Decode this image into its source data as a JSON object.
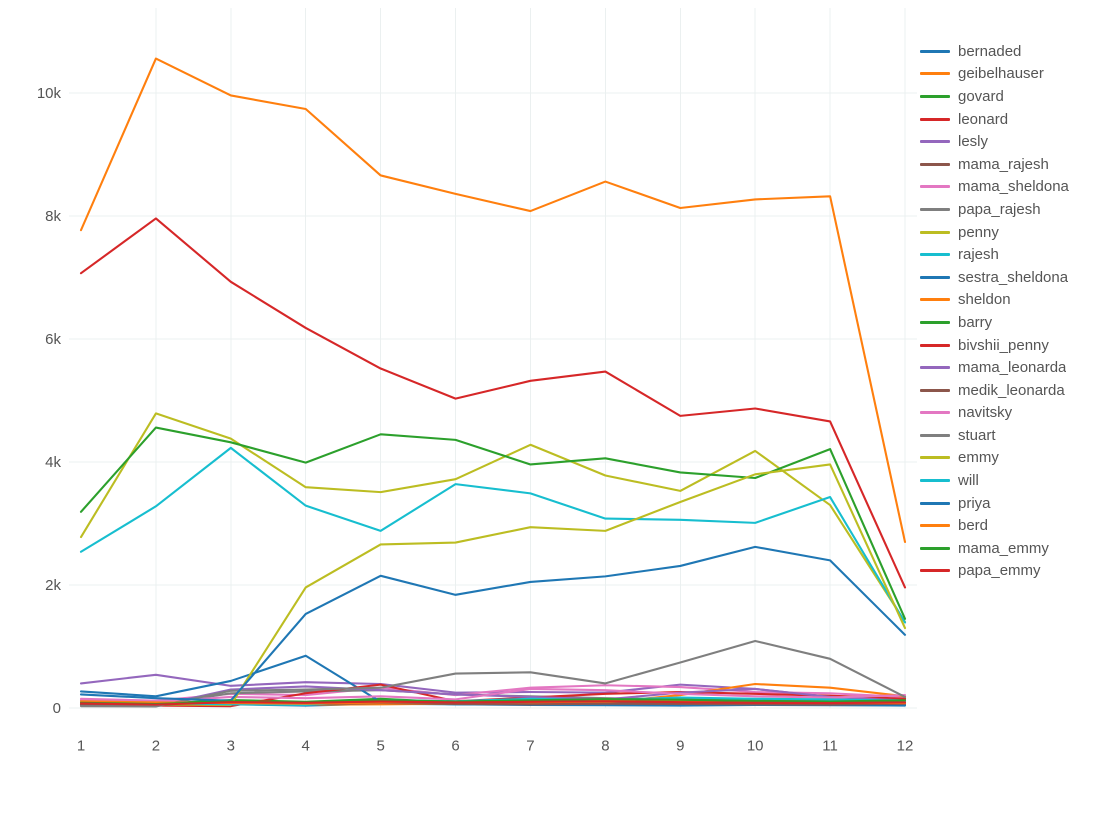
{
  "chart_data": {
    "type": "line",
    "title": "",
    "xlabel": "",
    "ylabel": "",
    "x": [
      1,
      2,
      3,
      4,
      5,
      6,
      7,
      8,
      9,
      10,
      11,
      12
    ],
    "xtick_labels": [
      "1",
      "2",
      "3",
      "4",
      "5",
      "6",
      "7",
      "8",
      "9",
      "10",
      "11",
      "12"
    ],
    "ytick_labels": [
      "0",
      "2k",
      "4k",
      "6k",
      "8k",
      "10k"
    ],
    "ytick_values": [
      0,
      2000,
      4000,
      6000,
      8000,
      10000
    ],
    "xlim": [
      1,
      12
    ],
    "ylim": [
      -140,
      10900
    ],
    "grid": true,
    "legend_position": "right",
    "series": [
      {
        "name": "bernaded",
        "color": "#1f77b4",
        "values": [
          120,
          80,
          60,
          40,
          70,
          60,
          55,
          50,
          45,
          60,
          55,
          50
        ]
      },
      {
        "name": "geibelhauser",
        "color": "#ff7f0e",
        "values": [
          7770,
          10560,
          9960,
          9740,
          8660,
          8360,
          8080,
          8560,
          8130,
          8270,
          8320,
          2700
        ]
      },
      {
        "name": "govard",
        "color": "#2ca02c",
        "values": [
          95,
          70,
          130,
          100,
          150,
          90,
          120,
          140,
          110,
          130,
          120,
          160
        ]
      },
      {
        "name": "leonard",
        "color": "#d62728",
        "values": [
          7070,
          7960,
          6930,
          6180,
          5520,
          5030,
          5320,
          5470,
          4750,
          4870,
          4660,
          1960
        ]
      },
      {
        "name": "lesly",
        "color": "#9467bd",
        "values": [
          400,
          540,
          360,
          420,
          390,
          250,
          260,
          250,
          380,
          310,
          180,
          140
        ]
      },
      {
        "name": "mama_rajesh",
        "color": "#8c564b",
        "values": [
          70,
          60,
          90,
          70,
          110,
          80,
          70,
          90,
          80,
          70,
          60,
          80
        ]
      },
      {
        "name": "mama_sheldona",
        "color": "#e377c2",
        "values": [
          150,
          120,
          230,
          210,
          330,
          210,
          330,
          370,
          340,
          260,
          240,
          180
        ]
      },
      {
        "name": "papa_rajesh",
        "color": "#7f7f7f",
        "values": [
          60,
          50,
          240,
          270,
          290,
          220,
          190,
          160,
          140,
          120,
          110,
          100
        ]
      },
      {
        "name": "penny",
        "color": "#bcbd22",
        "values": [
          2780,
          4790,
          4380,
          3590,
          3510,
          3720,
          4280,
          3780,
          3530,
          4180,
          3300,
          1400
        ]
      },
      {
        "name": "rajesh",
        "color": "#17becf",
        "values": [
          2540,
          3280,
          4230,
          3290,
          2880,
          3640,
          3490,
          3080,
          3060,
          3010,
          3430,
          1390
        ]
      },
      {
        "name": "sestra_sheldona",
        "color": "#1f77b4",
        "values": [
          270,
          190,
          440,
          850,
          100,
          60,
          50,
          45,
          40,
          50,
          45,
          40
        ]
      },
      {
        "name": "sheldon",
        "color": "#ff7f0e",
        "values": [
          90,
          70,
          60,
          55,
          60,
          70,
          80,
          90,
          210,
          390,
          330,
          190
        ]
      },
      {
        "name": "barry",
        "color": "#2ca02c",
        "values": [
          3190,
          4560,
          4320,
          3990,
          4450,
          4360,
          3960,
          4060,
          3830,
          3740,
          4210,
          1450
        ]
      },
      {
        "name": "bivshii_penny",
        "color": "#d62728",
        "values": [
          60,
          40,
          30,
          240,
          380,
          110,
          170,
          230,
          260,
          230,
          200,
          150
        ]
      },
      {
        "name": "mama_leonarda",
        "color": "#9467bd",
        "values": [
          40,
          35,
          300,
          350,
          290,
          220,
          180,
          140,
          250,
          310,
          180,
          120
        ]
      },
      {
        "name": "medik_leonarda",
        "color": "#8c564b",
        "values": [
          55,
          45,
          70,
          60,
          80,
          65,
          60,
          70,
          65,
          60,
          55,
          70
        ]
      },
      {
        "name": "navitsky",
        "color": "#e377c2",
        "values": [
          130,
          100,
          180,
          160,
          190,
          140,
          310,
          290,
          230,
          190,
          170,
          210
        ]
      },
      {
        "name": "stuart",
        "color": "#7f7f7f",
        "values": [
          30,
          25,
          280,
          300,
          330,
          560,
          580,
          400,
          740,
          1090,
          800,
          180
        ]
      },
      {
        "name": "emmy",
        "color": "#bcbd22",
        "values": [
          80,
          60,
          50,
          1960,
          2660,
          2690,
          2940,
          2880,
          3350,
          3800,
          3960,
          1300
        ]
      },
      {
        "name": "will",
        "color": "#17becf",
        "values": [
          100,
          80,
          60,
          50,
          130,
          110,
          150,
          130,
          170,
          150,
          140,
          120
        ]
      },
      {
        "name": "priya",
        "color": "#1f77b4",
        "values": [
          220,
          160,
          120,
          1530,
          2150,
          1840,
          2050,
          2140,
          2310,
          2620,
          2400,
          1190
        ]
      },
      {
        "name": "berd",
        "color": "#ff7f0e",
        "values": [
          110,
          90,
          80,
          70,
          90,
          100,
          110,
          130,
          120,
          100,
          90,
          80
        ]
      },
      {
        "name": "mama_emmy",
        "color": "#2ca02c",
        "values": [
          85,
          65,
          110,
          95,
          130,
          105,
          125,
          145,
          135,
          115,
          105,
          125
        ]
      },
      {
        "name": "papa_emmy",
        "color": "#d62728",
        "values": [
          75,
          55,
          95,
          85,
          105,
          90,
          100,
          110,
          95,
          85,
          80,
          90
        ]
      }
    ]
  },
  "legend": {
    "items": [
      {
        "label": "bernaded",
        "color": "#1f77b4"
      },
      {
        "label": "geibelhauser",
        "color": "#ff7f0e"
      },
      {
        "label": "govard",
        "color": "#2ca02c"
      },
      {
        "label": "leonard",
        "color": "#d62728"
      },
      {
        "label": "lesly",
        "color": "#9467bd"
      },
      {
        "label": "mama_rajesh",
        "color": "#8c564b"
      },
      {
        "label": "mama_sheldona",
        "color": "#e377c2"
      },
      {
        "label": "papa_rajesh",
        "color": "#7f7f7f"
      },
      {
        "label": "penny",
        "color": "#bcbd22"
      },
      {
        "label": "rajesh",
        "color": "#17becf"
      },
      {
        "label": "sestra_sheldona",
        "color": "#1f77b4"
      },
      {
        "label": "sheldon",
        "color": "#ff7f0e"
      },
      {
        "label": "barry",
        "color": "#2ca02c"
      },
      {
        "label": "bivshii_penny",
        "color": "#d62728"
      },
      {
        "label": "mama_leonarda",
        "color": "#9467bd"
      },
      {
        "label": "medik_leonarda",
        "color": "#8c564b"
      },
      {
        "label": "navitsky",
        "color": "#e377c2"
      },
      {
        "label": "stuart",
        "color": "#7f7f7f"
      },
      {
        "label": "emmy",
        "color": "#bcbd22"
      },
      {
        "label": "will",
        "color": "#17becf"
      },
      {
        "label": "priya",
        "color": "#1f77b4"
      },
      {
        "label": "berd",
        "color": "#ff7f0e"
      },
      {
        "label": "mama_emmy",
        "color": "#2ca02c"
      },
      {
        "label": "papa_emmy",
        "color": "#d62728"
      }
    ]
  },
  "colors": {
    "grid": "#EBF0F0",
    "tick_text": "#555555",
    "background": "#FFFFFF"
  }
}
